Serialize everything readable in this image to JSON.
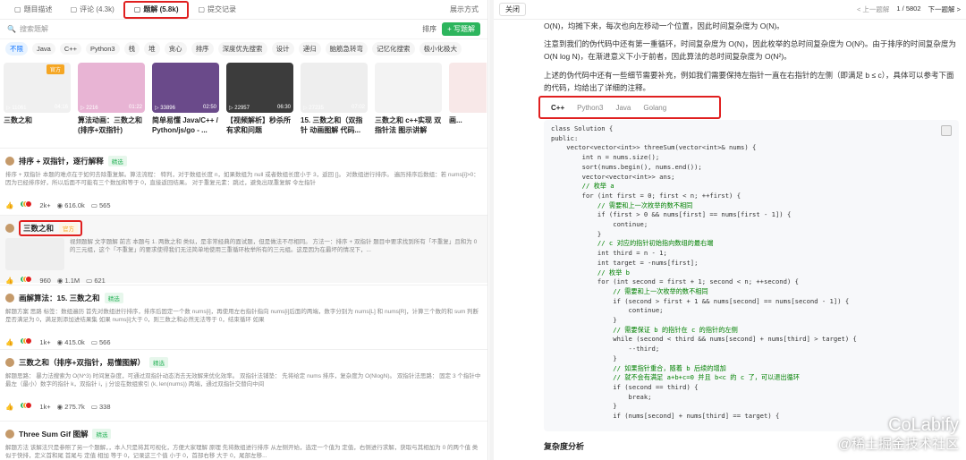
{
  "left_tabs": [
    {
      "label": "题目描述"
    },
    {
      "label": "评论 (4.3k)"
    },
    {
      "label": "题解 (5.8k)",
      "active": true
    },
    {
      "label": "提交记录"
    }
  ],
  "layout_btn": "展示方式",
  "search": {
    "placeholder": "搜索题解",
    "sort": "排序",
    "post": "+ 写题解"
  },
  "tags": [
    "不限",
    "Java",
    "C++",
    "Python3",
    "栈",
    "堆",
    "贪心",
    "排序",
    "深度优先搜索",
    "设计",
    "递归",
    "脑筋急转弯",
    "记忆化搜索",
    "极小化极大"
  ],
  "cards": [
    {
      "title": "三数之和",
      "views": "11061",
      "dur": "04:16",
      "official": "官方",
      "color": "#f0f0f0"
    },
    {
      "title": "算法动画：三数之和 (排序+双指针)",
      "views": "2216",
      "dur": "01:22",
      "color": "#e8b4d4"
    },
    {
      "title": "简单易懂 Java/C++ / Python/js/go - ...",
      "views": "33896",
      "dur": "02:50",
      "color": "#6a4a8a"
    },
    {
      "title": "【视频解析】秒杀所有求和问题",
      "views": "22957",
      "dur": "06:30",
      "color": "#3c3c3c"
    },
    {
      "title": "15. 三数之和（双指针 动画图解 代码...",
      "views": "27235",
      "dur": "07:02",
      "color": "#eeeeee"
    },
    {
      "title": "三数之和 c++实现 双指针法 图示讲解",
      "views": "",
      "dur": "",
      "color": "#f3f3f3"
    },
    {
      "title": "画...",
      "views": "",
      "dur": "",
      "color": "#f8e8e8"
    }
  ],
  "posts": [
    {
      "title": "排序 + 双指针，逐行解释",
      "badge": "精选",
      "desc": "排序 + 双指针 本题的难点在于如何去除重复解。算法流程： 特判，对于数组长度 n，如果数组为 null 或者数组长度小于 3，返回 []。 对数组进行排序。 遍历排序后数组：若 nums[i]>0：因为已经排序好，所以后面不可能有三个数加和等于 0，直接返回结果。 对于重复元素：跳过，避免出现重复解 令左指针",
      "likes": "2k+",
      "views": "616.0k",
      "comments": "565"
    },
    {
      "title": "三数之和",
      "badge": "官方",
      "desc": "视频题解 文字题解 前言 本题与 1. 两数之和 类似，是非常经典的面试题，但是做法不尽相同。 方法一：排序 + 双指针 题目中要求找到所有「不重复」且和为 0 的三元组，这个「不重复」的要求使得我们无法简单地使用三重循环枚举所有的三元组。这是因为在最坏的情况下，...",
      "likes": "960",
      "views": "1.1M",
      "comments": "621"
    },
    {
      "title": "画解算法：15. 三数之和",
      "badge": "精选",
      "desc": "解题方案 思路 标签：数组遍历 首先对数组进行排序，排序后固定一个数 nums[i]，再使用左右指针指向 nums[i]后面的两端，数字分别为 nums[L] 和 nums[R]，计算三个数的和 sum 判断是否满足为 0，满足则添加进结果集 如果 nums[i]大于 0，则三数之和必然无法等于 0，结束循环 如果",
      "likes": "1k+",
      "views": "415.0k",
      "comments": "566"
    },
    {
      "title": "三数之和（排序+双指针，易懂图解）",
      "badge": "精选",
      "desc": "解题思路： 暴力法搜索为 O(N^3) 时间复杂度，可通过双指针动态消去无效解来优化效率。 双指针法铺垫： 先将给定 nums 排序，复杂度为 O(NlogN)。 双指针法思路： 固定 3 个指针中最左（最小）数字的指针 k，双指针 i，j 分设在数组索引 (k, len(nums)) 两端，通过双指针交替向中间",
      "likes": "1k+",
      "views": "275.7k",
      "comments": "338"
    },
    {
      "title": "Three Sum Gif 图解",
      "badge": "精选",
      "desc": "解题方法 该解法只是参照了另一个题解，，本人只是将其可视化，方便大家理解 原理 先将数组进行排序 从左侧开始，选定一个值为 定值，右侧进行求解，获取与其相加为 0 的两个值 类似于快排，定义首和尾 首尾与 定值 相加 等于 0，记录这三个值 小于 0，首部右移 大于 0，尾部左移..."
    }
  ],
  "right": {
    "close": "关闭",
    "prev": "< 上一题解",
    "page": "1 / 5802",
    "next": "下一题解 >",
    "p1": "O(N)，均摊下来，每次也向左移动一个位置，因此时间复杂度为 O(N)。",
    "p2": "注意到我们的伪代码中还有第一重循环，时间复杂度为 O(N)，因此枚举的总时间复杂度为 O(N²)。由于排序的时间复杂度为 O(N log N)，在渐进意义下小于前者，因此算法的总时间复杂度为 O(N²)。",
    "p3": "上述的伪代码中还有一些细节需要补充，例如我们需要保持左指针一直在右指针的左侧（即满足 b ≤ c），具体可以参考下面的代码，均给出了详细的注释。",
    "lang_tabs": [
      "C++",
      "Python3",
      "Java",
      "Golang"
    ],
    "code_lines": [
      "class Solution {",
      "public:",
      "    vector<vector<int>> threeSum(vector<int>& nums) {",
      "        int n = nums.size();",
      "        sort(nums.begin(), nums.end());",
      "        vector<vector<int>> ans;",
      "        // 枚举 a",
      "        for (int first = 0; first < n; ++first) {",
      "            // 需要和上一次枚举的数不相同",
      "            if (first > 0 && nums[first] == nums[first - 1]) {",
      "                continue;",
      "            }",
      "            // c 对应的指针初始指向数组的最右端",
      "            int third = n - 1;",
      "            int target = -nums[first];",
      "            // 枚举 b",
      "            for (int second = first + 1; second < n; ++second) {",
      "                // 需要和上一次枚举的数不相同",
      "                if (second > first + 1 && nums[second] == nums[second - 1]) {",
      "                    continue;",
      "                }",
      "                // 需要保证 b 的指针在 c 的指针的左侧",
      "                while (second < third && nums[second] + nums[third] > target) {",
      "                    --third;",
      "                }",
      "                // 如果指针重合，随着 b 后续的增加",
      "                // 就不会有满足 a+b+c=0 并且 b<c 的 c 了，可以退出循环",
      "                if (second == third) {",
      "                    break;",
      "                }",
      "                if (nums[second] + nums[third] == target) {"
    ],
    "section": "复杂度分析",
    "watermark1": "CoLabify",
    "watermark2": "@稀土掘金技术社区"
  }
}
